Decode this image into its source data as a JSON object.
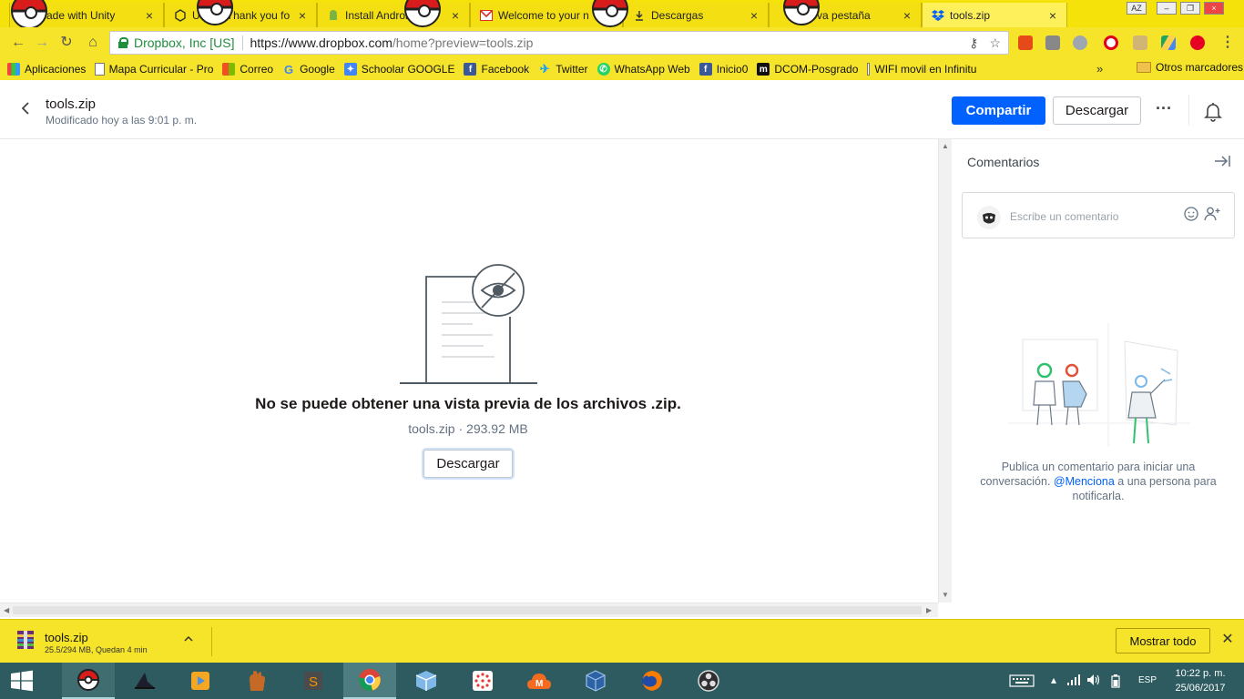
{
  "browser": {
    "tabs": [
      {
        "title": "Made with Unity",
        "favicon": "unity-icon"
      },
      {
        "title": "Unity - Thank you fo",
        "favicon": "unity-icon"
      },
      {
        "title": "Install Android",
        "favicon": "android-icon"
      },
      {
        "title": "Welcome to your n",
        "favicon": "gmail-icon"
      },
      {
        "title": "Descargas",
        "favicon": "download-icon"
      },
      {
        "title": "Nueva pestaña",
        "favicon": "blank-icon"
      },
      {
        "title": "tools.zip",
        "favicon": "dropbox-icon",
        "active": true
      }
    ],
    "omnibox": {
      "secure_label": "Dropbox, Inc [US]",
      "url_host": "https://www.dropbox.com",
      "url_path": "/home?preview=tools.zip"
    },
    "bookmarks": [
      {
        "label": "Aplicaciones",
        "icon": "apps-grid-icon"
      },
      {
        "label": "Mapa Curricular - Pro",
        "icon": "page-icon"
      },
      {
        "label": "Correo",
        "icon": "microsoft-icon"
      },
      {
        "label": "Google",
        "icon": "google-icon"
      },
      {
        "label": "Schoolar GOOGLE",
        "icon": "scholar-icon"
      },
      {
        "label": "Facebook",
        "icon": "facebook-icon"
      },
      {
        "label": "Twitter",
        "icon": "twitter-icon"
      },
      {
        "label": "WhatsApp Web",
        "icon": "whatsapp-icon"
      },
      {
        "label": "Inicio0",
        "icon": "facebook-icon"
      },
      {
        "label": "DCOM-Posgrado",
        "icon": "m-icon"
      },
      {
        "label": "WIFI movil en Infinitu",
        "icon": "page-icon"
      }
    ],
    "bookmarks_more": "»",
    "bookmarks_other": "Otros marcadores"
  },
  "header": {
    "file_name": "tools.zip",
    "modified": "Modificado hoy a las 9:01 p. m.",
    "share_label": "Compartir",
    "download_label": "Descargar",
    "more_label": "···"
  },
  "preview": {
    "message": "No se puede obtener una vista previa de los archivos .zip.",
    "file_meta": "tools.zip · 293.92 MB",
    "download_label": "Descargar"
  },
  "comments": {
    "title": "Comentarios",
    "input_placeholder": "Escribe un comentario",
    "empty_part1": "Publica un comentario para iniciar una conversación.",
    "empty_mention": "@Menciona",
    "empty_part2": "a una persona para notificarla."
  },
  "download_shelf": {
    "file_name": "tools.zip",
    "status": "25.5/294 MB, Quedan 4 min",
    "show_all_label": "Mostrar todo"
  },
  "taskbar": {
    "language": "ESP",
    "time": "10:22 p. m.",
    "date": "25/06/2017"
  },
  "colors": {
    "dropbox_blue": "#0061fe",
    "theme_yellow": "#f6e42a",
    "taskbar": "#2d5b5f"
  }
}
